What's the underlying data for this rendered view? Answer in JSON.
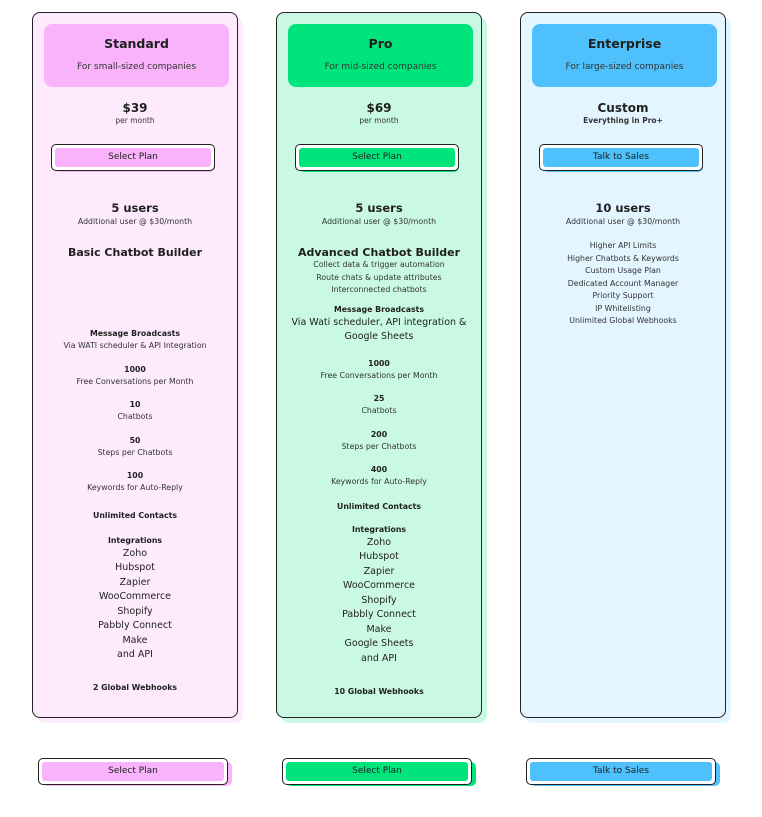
{
  "colors": {
    "standard_accent": "#f8b3fa",
    "pro_accent": "#00e47c",
    "enterprise_accent": "#4ec0fb",
    "standard_bg": "#fdeafd",
    "pro_bg": "#c9f9e2",
    "enterprise_bg": "#e3f5ff"
  },
  "standard": {
    "name": "Standard",
    "desc": "For small-sized companies",
    "price": "$39",
    "period": "per month",
    "button": "Select Plan",
    "users": "5 users",
    "users_sub": "Additional user @ $30/month",
    "builder": "Basic Chatbot Builder",
    "broadcast_title": "Message Broadcasts",
    "broadcast_sub": "Via WATI scheduler & API Integration",
    "stats": [
      {
        "num": "1000",
        "label": "Free Conversations per Month"
      },
      {
        "num": "10",
        "label": "Chatbots"
      },
      {
        "num": "50",
        "label": "Steps per Chatbots"
      },
      {
        "num": "100",
        "label": "Keywords for Auto-Reply"
      }
    ],
    "contacts": "Unlimited Contacts",
    "integrations_title": "Integrations",
    "integrations": [
      "Zoho",
      "Hubspot",
      "Zapier",
      "WooCommerce",
      "Shopify",
      "Pabbly Connect",
      "Make",
      "and API"
    ],
    "webhooks": "2 Global Webhooks"
  },
  "pro": {
    "name": "Pro",
    "desc": "For mid-sized companies",
    "price": "$69",
    "period": "per month",
    "button": "Select Plan",
    "users": "5 users",
    "users_sub": "Additional user @ $30/month",
    "builder": "Advanced Chatbot Builder",
    "builder_lines": [
      "Collect data & trigger automation",
      "Route chats & update attributes",
      "Interconnected chatbots"
    ],
    "broadcast_title": "Message Broadcasts",
    "broadcast_lines": [
      "Via Wati scheduler, API integration &",
      "Google Sheets"
    ],
    "stats": [
      {
        "num": "1000",
        "label": "Free Conversations per Month"
      },
      {
        "num": "25",
        "label": "Chatbots"
      },
      {
        "num": "200",
        "label": "Steps per Chatbots"
      },
      {
        "num": "400",
        "label": "Keywords for Auto-Reply"
      }
    ],
    "contacts": "Unlimited Contacts",
    "integrations_title": "Integrations",
    "integrations": [
      "Zoho",
      "Hubspot",
      "Zapier",
      "WooCommerce",
      "Shopify",
      "Pabbly Connect",
      "Make",
      "Google Sheets",
      "and API"
    ],
    "webhooks": "10 Global Webhooks"
  },
  "enterprise": {
    "name": "Enterprise",
    "desc": "For large-sized companies",
    "price": "Custom",
    "period": "Everything in Pro+",
    "button": "Talk to Sales",
    "users": "10 users",
    "users_sub": "Additional user @ $30/month",
    "features": [
      "Higher API Limits",
      "Higher Chatbots & Keywords",
      "Custom Usage Plan",
      "Dedicated Account Manager",
      "Priority Support",
      "IP Whitelisting",
      "Unlimited Global Webhooks"
    ]
  },
  "bottom": {
    "standard_button": "Select Plan",
    "pro_button": "Select Plan",
    "enterprise_button": "Talk to Sales"
  }
}
